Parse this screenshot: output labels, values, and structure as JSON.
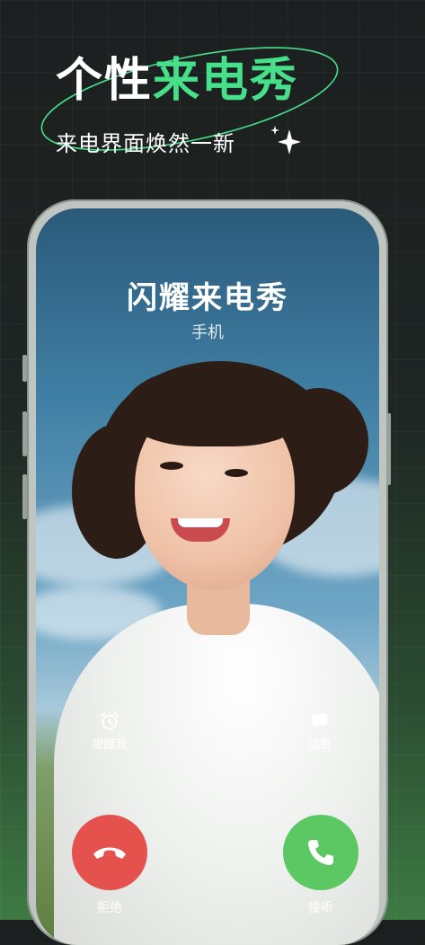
{
  "banner": {
    "title_white": "个性",
    "title_green": "来电秀",
    "subtitle": "来电界面焕然一新"
  },
  "call_screen": {
    "caller_name": "闪耀来电秀",
    "caller_type": "手机",
    "reminder_label": "提醒我",
    "message_label": "信息",
    "decline_label": "拒绝",
    "accept_label": "接听"
  },
  "colors": {
    "accent_green": "#47e08a",
    "decline_red": "#e5514d",
    "accept_green": "#5bc864"
  },
  "icons": {
    "sparkle": "sparkle-icon",
    "alarm": "alarm-clock-icon",
    "message": "chat-bubble-icon",
    "decline": "phone-hangup-icon",
    "accept": "phone-icon"
  }
}
